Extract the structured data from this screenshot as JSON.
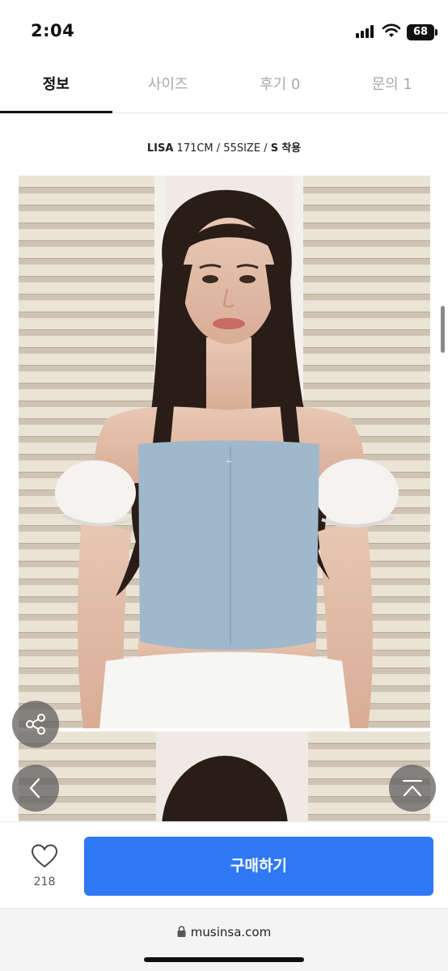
{
  "status": {
    "time": "2:04",
    "battery": "68"
  },
  "tabs": [
    {
      "label": "정보"
    },
    {
      "label": "사이즈"
    },
    {
      "label": "후기 0"
    },
    {
      "label": "문의 1"
    }
  ],
  "model_info": {
    "name": "LISA",
    "spec": "171CM / 55SIZE /",
    "size": "S",
    "suffix": "착용"
  },
  "product": {
    "like_count": "218",
    "buy_label": "구매하기"
  },
  "browser": {
    "url": "musinsa.com"
  },
  "colors": {
    "accent": "#2f79f6",
    "top_color": "#9fb8cc"
  },
  "icons": [
    "signal-icon",
    "wifi-icon",
    "battery-icon",
    "share-icon",
    "back-arrow-icon",
    "scroll-top-icon",
    "heart-icon",
    "lock-icon"
  ]
}
